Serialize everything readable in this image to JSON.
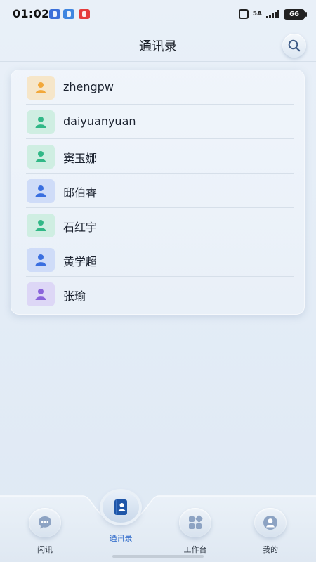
{
  "status_bar": {
    "time": "01:02",
    "network": "5A",
    "battery": "66"
  },
  "header": {
    "title": "通讯录"
  },
  "contacts": [
    {
      "name": "zhengpw",
      "bg": "#f6e6c9",
      "fg": "#f2a83a"
    },
    {
      "name": "daiyuanyuan",
      "bg": "#cfeee2",
      "fg": "#31b887"
    },
    {
      "name": "窦玉娜",
      "bg": "#cfeee2",
      "fg": "#31b887"
    },
    {
      "name": "邸伯睿",
      "bg": "#cfdcf8",
      "fg": "#3a6fe0"
    },
    {
      "name": "石红宇",
      "bg": "#cfeee2",
      "fg": "#31b887"
    },
    {
      "name": "黄学超",
      "bg": "#cfdcf8",
      "fg": "#3a6fe0"
    },
    {
      "name": "张瑜",
      "bg": "#ddd7f6",
      "fg": "#8a63db"
    }
  ],
  "bottom_nav": [
    {
      "label": "闪讯",
      "icon": "chat-bubble-icon",
      "active": false
    },
    {
      "label": "通讯录",
      "icon": "contacts-book-icon",
      "active": true
    },
    {
      "label": "工作台",
      "icon": "apps-grid-icon",
      "active": false
    },
    {
      "label": "我的",
      "icon": "person-icon",
      "active": false
    }
  ],
  "colors": {
    "accent": "#2a67c9",
    "background": "#e6eef7"
  }
}
